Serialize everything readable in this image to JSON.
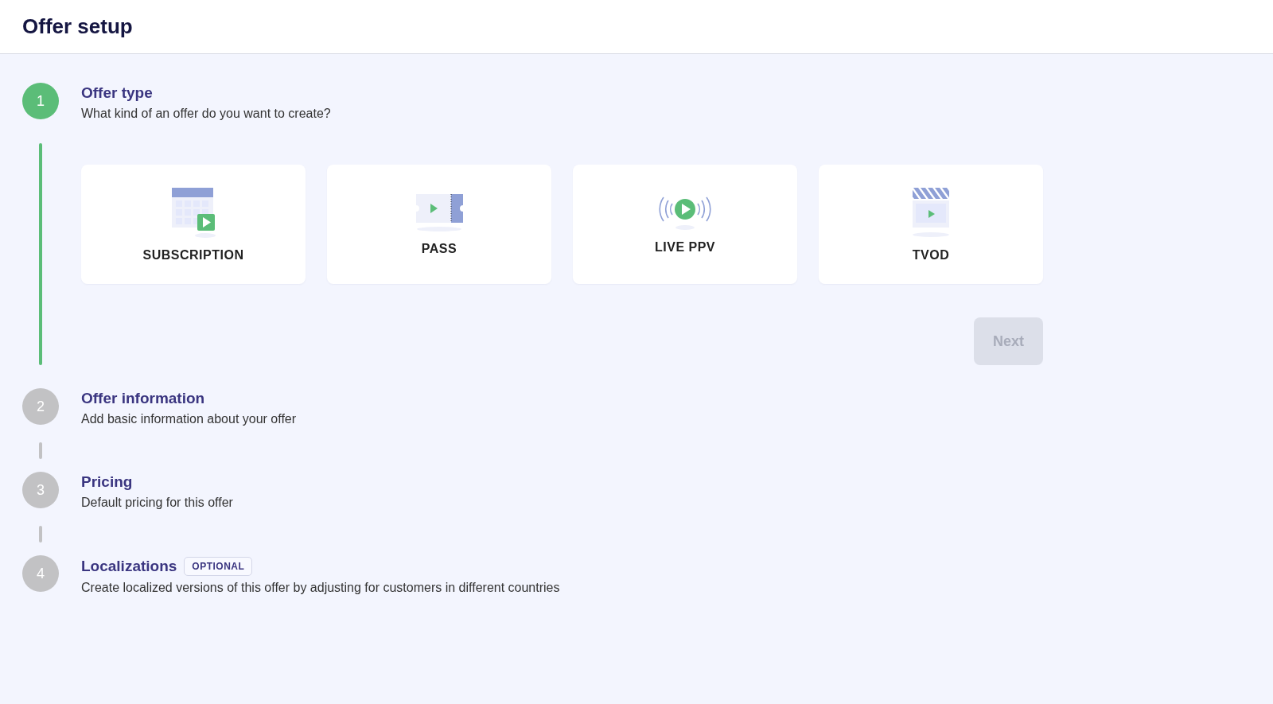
{
  "header": {
    "title": "Offer setup"
  },
  "steps": [
    {
      "number": "1",
      "title": "Offer type",
      "description": "What kind of an offer do you want to create?",
      "active": true,
      "options": [
        {
          "kind": "calendar",
          "label": "SUBSCRIPTION"
        },
        {
          "kind": "ticket",
          "label": "PASS"
        },
        {
          "kind": "live",
          "label": "LIVE PPV"
        },
        {
          "kind": "clapper",
          "label": "TVOD"
        }
      ],
      "next_button": {
        "label": "Next",
        "disabled": true
      }
    },
    {
      "number": "2",
      "title": "Offer information",
      "description": "Add basic information about your offer",
      "active": false
    },
    {
      "number": "3",
      "title": "Pricing",
      "description": "Default pricing for this offer",
      "active": false
    },
    {
      "number": "4",
      "title": "Localizations",
      "badge": "OPTIONAL",
      "description": "Create localized versions of this offer by adjusting for customers in different countries",
      "active": false
    }
  ]
}
